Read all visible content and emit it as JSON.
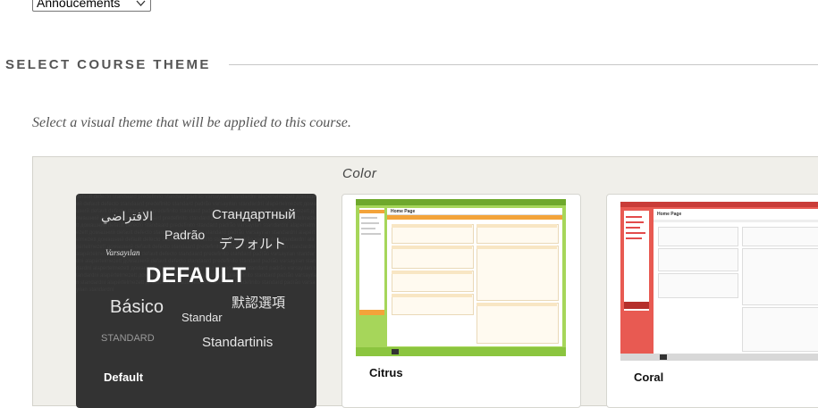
{
  "dropdown": {
    "selected": "Annoucements"
  },
  "section": {
    "title": "SELECT COURSE THEME",
    "description": "Select a visual theme that will be applied to this course."
  },
  "theme_group": {
    "label": "Color",
    "themes": [
      {
        "name": "Default",
        "words": {
          "arabic": "الافتراضي",
          "russian": "Стандартный",
          "portuguese": "Padrão",
          "japanese": "デフォルト",
          "turkish": "Varsayılan",
          "english": "DEFAULT",
          "chinese": "默認選項",
          "spanish": "Básico",
          "french": "Standar",
          "standard": "STANDARD",
          "lithuanian": "Standartinis"
        }
      },
      {
        "name": "Citrus"
      },
      {
        "name": "Coral"
      }
    ],
    "preview_page_title": "Home Page"
  },
  "colors": {
    "citrus_accent": "#8bc53f",
    "citrus_header": "#f3a33a",
    "coral_accent": "#e24b4b",
    "default_card": "#333333"
  }
}
